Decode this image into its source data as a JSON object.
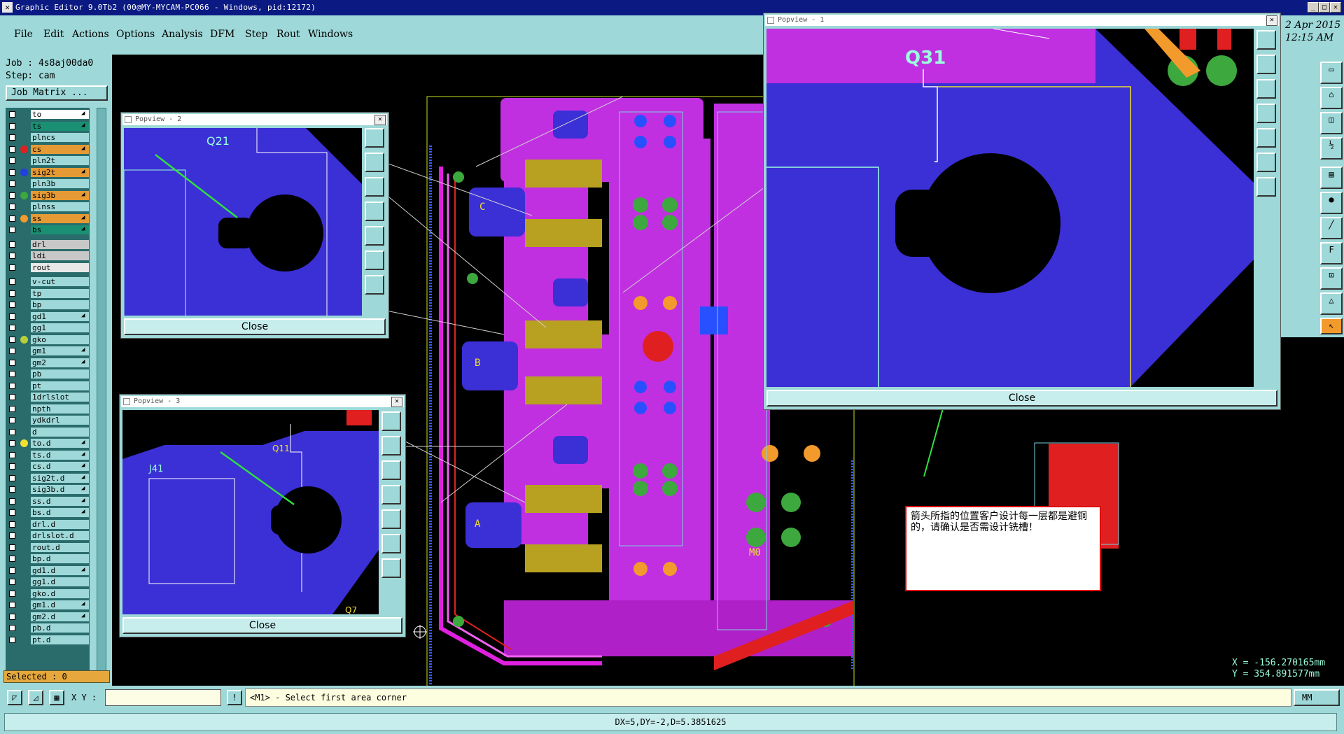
{
  "window": {
    "title": "Graphic Editor 9.0Tb2 (00@MY-MYCAM-PC066 - Windows, pid:12172)",
    "minimize": "_",
    "maximize": "□",
    "close": "✕"
  },
  "menubar": [
    "File",
    "Edit",
    "Actions",
    "Options",
    "Analysis",
    "DFM",
    "Step",
    "Rout",
    "Windows"
  ],
  "date": {
    "line1": "2 Apr 2015",
    "line2": "12:15 AM"
  },
  "job": {
    "job_line": "Job : 4s8aj00da0",
    "step_line": "Step: cam",
    "matrix_button": "Job Matrix ..."
  },
  "layers": [
    {
      "name": "to",
      "dot": "",
      "bg": "#ffffff",
      "edit": "◢"
    },
    {
      "name": "ts",
      "dot": "",
      "bg": "#1b8f73",
      "edit": "◢"
    },
    {
      "name": "plncs",
      "dot": "",
      "bg": "#9ed8d8",
      "edit": ""
    },
    {
      "name": "cs",
      "dot": "#e02020",
      "bg": "#e69a35",
      "edit": "◢"
    },
    {
      "name": "pln2t",
      "dot": "",
      "bg": "#9ed8d8",
      "edit": ""
    },
    {
      "name": "sig2t",
      "dot": "#2040e0",
      "bg": "#e69a35",
      "edit": "◢"
    },
    {
      "name": "pln3b",
      "dot": "",
      "bg": "#9ed8d8",
      "edit": ""
    },
    {
      "name": "sig3b",
      "dot": "#3da83d",
      "bg": "#e69a35",
      "edit": "◢"
    },
    {
      "name": "plnss",
      "dot": "",
      "bg": "#9ed8d8",
      "edit": ""
    },
    {
      "name": "ss",
      "dot": "#f39a2c",
      "bg": "#e69a35",
      "edit": "◢"
    },
    {
      "name": "bs",
      "dot": "",
      "bg": "#1b8f73",
      "edit": "◢"
    },
    {
      "name": "drl",
      "dot": "",
      "bg": "#c8c8c8",
      "edit": ""
    },
    {
      "name": "ldi",
      "dot": "",
      "bg": "#c8c8c8",
      "edit": ""
    },
    {
      "name": "rout",
      "dot": "",
      "bg": "#e8e8e8",
      "edit": ""
    },
    {
      "name": "v-cut",
      "dot": "",
      "bg": "#9ed8d8",
      "edit": ""
    },
    {
      "name": "tp",
      "dot": "",
      "bg": "#9ed8d8",
      "edit": ""
    },
    {
      "name": "bp",
      "dot": "",
      "bg": "#9ed8d8",
      "edit": ""
    },
    {
      "name": "gd1",
      "dot": "",
      "bg": "#9ed8d8",
      "edit": "◢"
    },
    {
      "name": "gg1",
      "dot": "",
      "bg": "#9ed8d8",
      "edit": ""
    },
    {
      "name": "gko",
      "dot": "#b7cf3a",
      "bg": "#9ed8d8",
      "edit": ""
    },
    {
      "name": "gm1",
      "dot": "",
      "bg": "#9ed8d8",
      "edit": "◢"
    },
    {
      "name": "gm2",
      "dot": "",
      "bg": "#9ed8d8",
      "edit": "◢"
    },
    {
      "name": "pb",
      "dot": "",
      "bg": "#9ed8d8",
      "edit": ""
    },
    {
      "name": "pt",
      "dot": "",
      "bg": "#9ed8d8",
      "edit": ""
    },
    {
      "name": "1drlslot",
      "dot": "",
      "bg": "#9ed8d8",
      "edit": ""
    },
    {
      "name": "npth",
      "dot": "",
      "bg": "#9ed8d8",
      "edit": ""
    },
    {
      "name": "ydkdrl",
      "dot": "",
      "bg": "#9ed8d8",
      "edit": ""
    },
    {
      "name": "d",
      "dot": "",
      "bg": "#9ed8d8",
      "edit": ""
    },
    {
      "name": "to.d",
      "dot": "#f0e030",
      "bg": "#9ed8d8",
      "edit": "◢"
    },
    {
      "name": "ts.d",
      "dot": "",
      "bg": "#9ed8d8",
      "edit": "◢"
    },
    {
      "name": "cs.d",
      "dot": "",
      "bg": "#9ed8d8",
      "edit": "◢"
    },
    {
      "name": "sig2t.d",
      "dot": "",
      "bg": "#9ed8d8",
      "edit": "◢"
    },
    {
      "name": "sig3b.d",
      "dot": "",
      "bg": "#9ed8d8",
      "edit": "◢"
    },
    {
      "name": "ss.d",
      "dot": "",
      "bg": "#9ed8d8",
      "edit": "◢"
    },
    {
      "name": "bs.d",
      "dot": "",
      "bg": "#9ed8d8",
      "edit": "◢"
    },
    {
      "name": "drl.d",
      "dot": "",
      "bg": "#9ed8d8",
      "edit": ""
    },
    {
      "name": "drlslot.d",
      "dot": "",
      "bg": "#9ed8d8",
      "edit": ""
    },
    {
      "name": "rout.d",
      "dot": "",
      "bg": "#9ed8d8",
      "edit": ""
    },
    {
      "name": "bp.d",
      "dot": "",
      "bg": "#9ed8d8",
      "edit": ""
    },
    {
      "name": "gd1.d",
      "dot": "",
      "bg": "#9ed8d8",
      "edit": "◢"
    },
    {
      "name": "gg1.d",
      "dot": "",
      "bg": "#9ed8d8",
      "edit": ""
    },
    {
      "name": "gko.d",
      "dot": "",
      "bg": "#9ed8d8",
      "edit": ""
    },
    {
      "name": "gm1.d",
      "dot": "",
      "bg": "#9ed8d8",
      "edit": "◢"
    },
    {
      "name": "gm2.d",
      "dot": "",
      "bg": "#9ed8d8",
      "edit": "◢"
    },
    {
      "name": "pb.d",
      "dot": "",
      "bg": "#9ed8d8",
      "edit": ""
    },
    {
      "name": "pt.d",
      "dot": "",
      "bg": "#9ed8d8",
      "edit": ""
    }
  ],
  "selected": "Selected : 0",
  "cmd": {
    "xy_label": "X Y :",
    "xy_value": "",
    "info_button": "!",
    "prompt": "<M1> - Select first area corner",
    "units": "MM"
  },
  "status": "DX=5,DY=-2,D=5.3851625",
  "coords": {
    "x": "X = -156.270165mm",
    "y": "Y = 354.891577mm"
  },
  "popups": {
    "p1": {
      "title": "Popview - 1",
      "label": "Q31",
      "close": "Close"
    },
    "p2": {
      "title": "Popview - 2",
      "label": "Q21",
      "close": "Close"
    },
    "p3": {
      "title": "Popview - 3",
      "label": "Q11",
      "label2": "J41",
      "label3": "Q7",
      "close": "Close"
    }
  },
  "note": "箭头所指的位置客户设计每一层都是避铜的，请确认是否需设计铣槽！",
  "board": {
    "labels": [
      "C",
      "B",
      "A",
      "M0"
    ]
  },
  "colors": {
    "panel": "#9ed8d8",
    "titlebar": "#0a1a82",
    "copper_blue": "#3b2fd6",
    "copper_magenta": "#c030e0",
    "pad_green": "#3da83d",
    "arrow_green": "#30e040",
    "note_border": "#e00000"
  }
}
